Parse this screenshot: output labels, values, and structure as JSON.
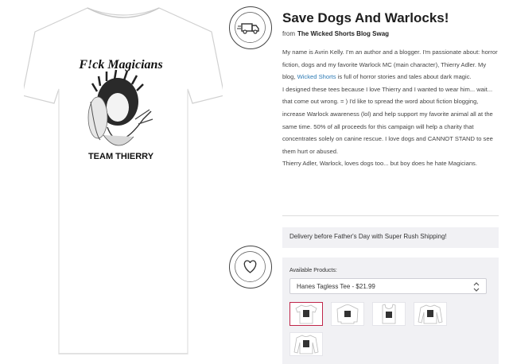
{
  "product": {
    "shirt_text_top": "F!ck Magicians",
    "shirt_text_bottom": "TEAM THIERRY"
  },
  "badges": {
    "rush_text": "RUSH SHIPPING AVAILABLE",
    "charity_text": "VERIFIED CHARITY CONTRIBUTOR"
  },
  "header": {
    "title": "Save Dogs And Warlocks!",
    "from_label": "from",
    "store_name": "The Wicked Shorts Blog Swag"
  },
  "description": {
    "p1_before_link": "My name is Avrin Kelly. I'm an author and a blogger. I'm passionate about: horror fiction, dogs and my favorite Warlock MC (main character), Thierry Adler. My blog, ",
    "p1_link": "Wicked Shorts",
    "p1_after_link": " is full of horror stories and tales about dark magic.",
    "p2": "I designed these tees because I love Thierry and I wanted to wear him... wait... that come out wrong. = ) I'd like to spread the word about fiction blogging, increase Warlock awareness (lol) and help support my favorite animal all at the same time.  50% of all proceeds for this campaign will help a charity that concentrates solely on canine rescue. I love dogs and CANNOT STAND to see them hurt or abused.",
    "p3": "Thierry Adler, Warlock, loves dogs too... but boy does he hate Magicians."
  },
  "shipping": {
    "message": "Delivery before Father's Day with Super Rush Shipping!"
  },
  "products": {
    "label": "Available Products:",
    "selected": "Hanes Tagless Tee - $21.99",
    "thumbnails": [
      "Hanes Tagless Tee",
      "Hoodie",
      "Tank Top",
      "Long Sleeve",
      "Sweatshirt"
    ]
  },
  "colors": {
    "accent": "#c0264a",
    "link": "#2e7bb5",
    "panel_bg": "#f1f1f4"
  }
}
